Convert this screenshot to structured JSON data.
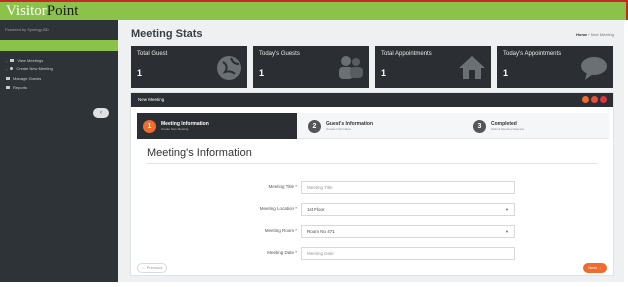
{
  "app": {
    "brand_part1": "Visitor",
    "brand_part2": "Point"
  },
  "sidebar": {
    "powered_by": "Powered by Synergy-BD",
    "items": [
      {
        "label": "View Meetings",
        "bullet": "-",
        "icon": "grid-icon"
      },
      {
        "label": "Create New Meeting",
        "bullet": "-",
        "icon": "dot-icon"
      },
      {
        "label": "Manage Guests",
        "icon": "users-icon"
      },
      {
        "label": "Reports",
        "icon": "report-icon"
      }
    ],
    "collapse_label": "‹"
  },
  "header": {
    "title": "Meeting Stats",
    "breadcrumb": {
      "home": "Home",
      "separator": "/",
      "current": "New Meeting"
    }
  },
  "stats": [
    {
      "label": "Total Guest",
      "value": "1",
      "icon": "globe-icon"
    },
    {
      "label": "Today's Guests",
      "value": "1",
      "icon": "users-icon"
    },
    {
      "label": "Total Appointments",
      "value": "1",
      "icon": "house-icon"
    },
    {
      "label": "Today's Appointments",
      "value": "1",
      "icon": "chat-icon"
    }
  ],
  "panel": {
    "title": "New Meeting",
    "dot_colors": [
      "#ef6c2e",
      "#e84f3d",
      "#d9363e"
    ]
  },
  "wizard": {
    "steps": [
      {
        "num": "1",
        "title": "Meeting Information",
        "subtitle": "Create New Meeting",
        "active": true
      },
      {
        "num": "2",
        "title": "Guest's Information",
        "subtitle": "Guests Information",
        "active": false
      },
      {
        "num": "3",
        "title": "Completed",
        "subtitle": "Submit Meeting Request",
        "active": false
      }
    ]
  },
  "form": {
    "section_title": "Meeting's Information",
    "fields": [
      {
        "label": "Meeting Title *",
        "value": "",
        "placeholder": "Meeting Title",
        "type": "text"
      },
      {
        "label": "Meeting Location *",
        "value": "1st Floor",
        "placeholder": "",
        "type": "select"
      },
      {
        "label": "Meeting Room *",
        "value": "Room No 471",
        "placeholder": "",
        "type": "select"
      },
      {
        "label": "Meeting Date *",
        "value": "",
        "placeholder": "Meeting Date",
        "type": "text"
      }
    ],
    "prev_label": "← Previous",
    "next_label": "Next →"
  },
  "colors": {
    "accent_green": "#8bc34a",
    "accent_orange": "#ef6c2e",
    "dark": "#2b2f33"
  }
}
